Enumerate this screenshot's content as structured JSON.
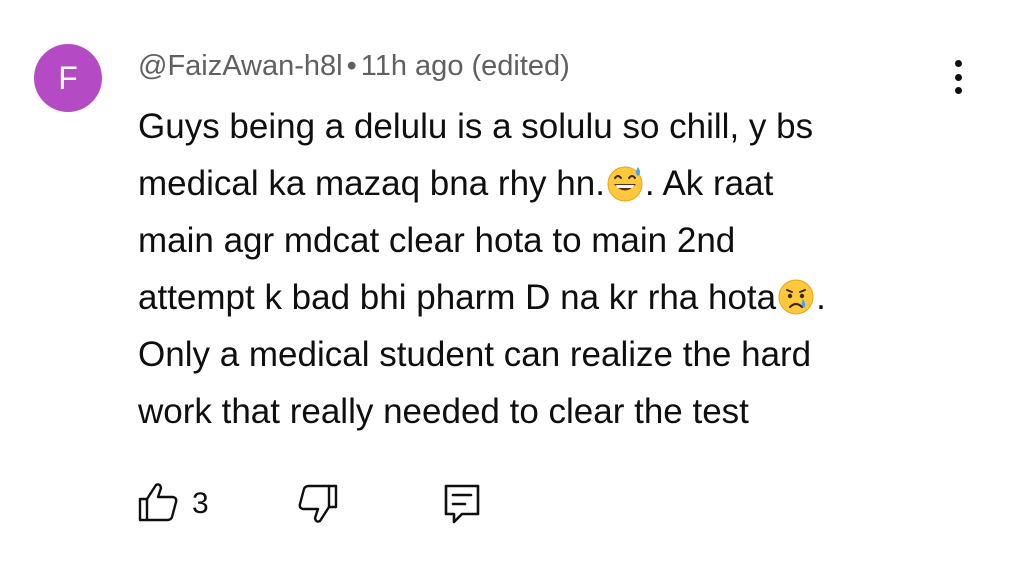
{
  "comment": {
    "avatar_letter": "F",
    "avatar_color": "#b44bc4",
    "author": "@FaizAwan-h8l",
    "separator": "•",
    "timestamp": "11h ago (edited)",
    "lines": {
      "l1": "Guys being a delulu is a solulu so chill, y bs",
      "l2a": "medical ka mazaq bna rhy hn.",
      "l2b": ". Ak raat",
      "l3": "main agr mdcat clear hota to main 2nd",
      "l4a": "attempt k bad bhi pharm D na kr rha hota",
      "l4b": ".",
      "l5": "Only a medical student can realize the hard",
      "l6": "work that really needed to clear the test"
    },
    "emojis": {
      "first": "grinning-face-with-sweat-emoji",
      "second": "crying-face-emoji"
    }
  },
  "actions": {
    "like_icon": "thumbs-up-icon",
    "like_count": "3",
    "dislike_icon": "thumbs-down-icon",
    "reply_icon": "reply-comment-icon"
  },
  "menu": {
    "icon": "more-vertical-icon"
  }
}
